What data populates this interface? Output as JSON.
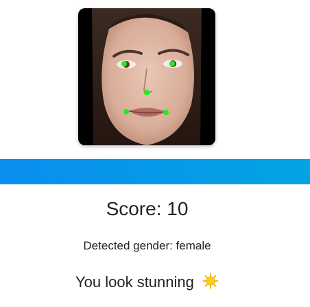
{
  "photo": {
    "landmark_color": "#1cf01c"
  },
  "progress": {
    "fraction": 1.0,
    "color_start": "#0a8ef0",
    "color_end": "#03a4e2"
  },
  "result": {
    "score_label": "Score: 10",
    "gender_label": "Detected gender: female",
    "message": "You look stunning",
    "message_icon": "sun-emoji-icon"
  }
}
